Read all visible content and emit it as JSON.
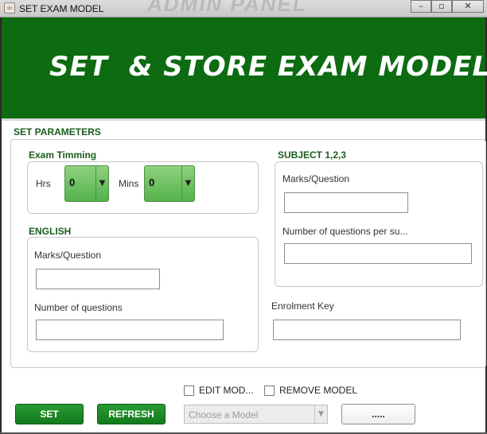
{
  "window": {
    "title": "SET EXAM MODEL",
    "background_title": "ADMIN PANEL",
    "minimize_glyph": "–",
    "maximize_glyph": "▫",
    "close_glyph": "✕",
    "app_icon": "java-icon"
  },
  "banner": {
    "title": "SET  & STORE EXAM MODEL",
    "color": "#0d6b12"
  },
  "parameters": {
    "section_label": "SET PARAMETERS",
    "exam_timing": {
      "label": "Exam Timming",
      "hrs_label": "Hrs",
      "hrs_value": "0",
      "mins_label": "Mins",
      "mins_value": "0"
    },
    "english": {
      "label": "ENGLISH",
      "marks_label": "Marks/Question",
      "marks_value": "",
      "questions_label": "Number of questions",
      "questions_value": ""
    },
    "subject": {
      "label": "SUBJECT 1,2,3",
      "marks_label": "Marks/Question",
      "marks_value": "",
      "questions_label": "Number of questions per su...",
      "questions_value": ""
    },
    "enrolment": {
      "label": "Enrolment Key",
      "value": ""
    }
  },
  "footer": {
    "edit_model_label": "EDIT MOD...",
    "remove_model_label": "REMOVE MODEL",
    "set_label": "SET",
    "refresh_label": "REFRESH",
    "model_combo_value": "Choose a Model",
    "browse_label": ".....",
    "accent": "#137a1c"
  }
}
